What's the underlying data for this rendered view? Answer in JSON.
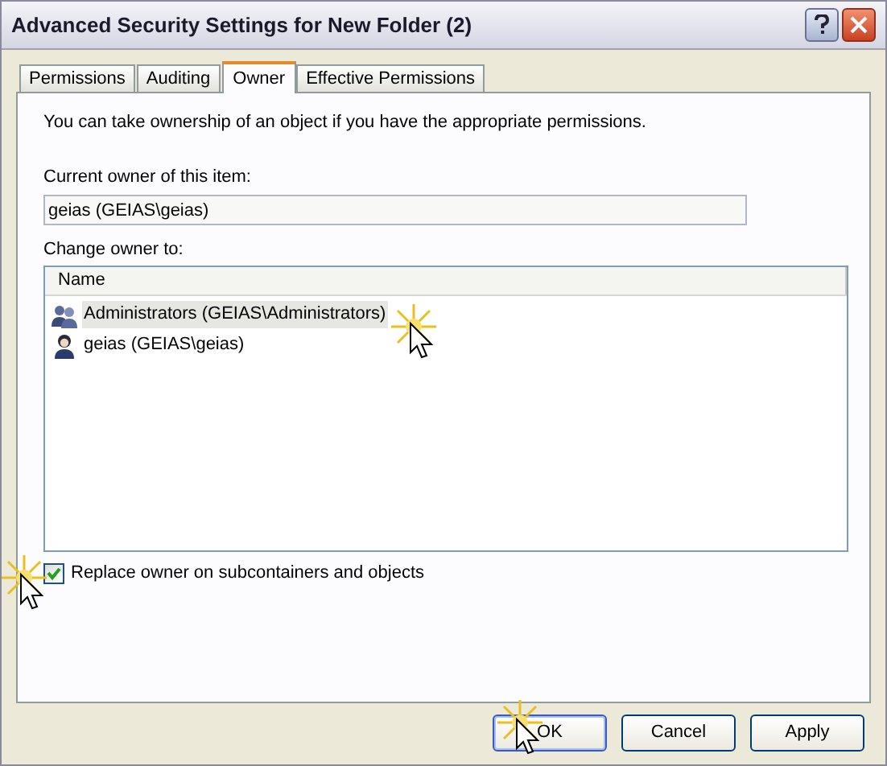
{
  "window": {
    "title": "Advanced Security Settings for New Folder (2)"
  },
  "tabs": [
    {
      "label": "Permissions",
      "selected": false
    },
    {
      "label": "Auditing",
      "selected": false
    },
    {
      "label": "Owner",
      "selected": true
    },
    {
      "label": "Effective Permissions",
      "selected": false
    }
  ],
  "description": "You can take ownership of an object if you have the appropriate permissions.",
  "current_owner": {
    "label": "Current owner of this item:",
    "value": "geias (GEIAS\\geias)"
  },
  "change_owner": {
    "label": "Change owner to:",
    "columns": [
      "Name"
    ],
    "rows": [
      {
        "label": "Administrators (GEIAS\\Administrators)",
        "kind": "group",
        "selected": true
      },
      {
        "label": "geias (GEIAS\\geias)",
        "kind": "user",
        "selected": false
      }
    ]
  },
  "replace_option": {
    "label": "Replace owner on subcontainers and objects",
    "checked": true
  },
  "buttons": [
    {
      "label": "OK",
      "default": true
    },
    {
      "label": "Cancel",
      "default": false
    },
    {
      "label": "Apply",
      "default": false
    }
  ]
}
